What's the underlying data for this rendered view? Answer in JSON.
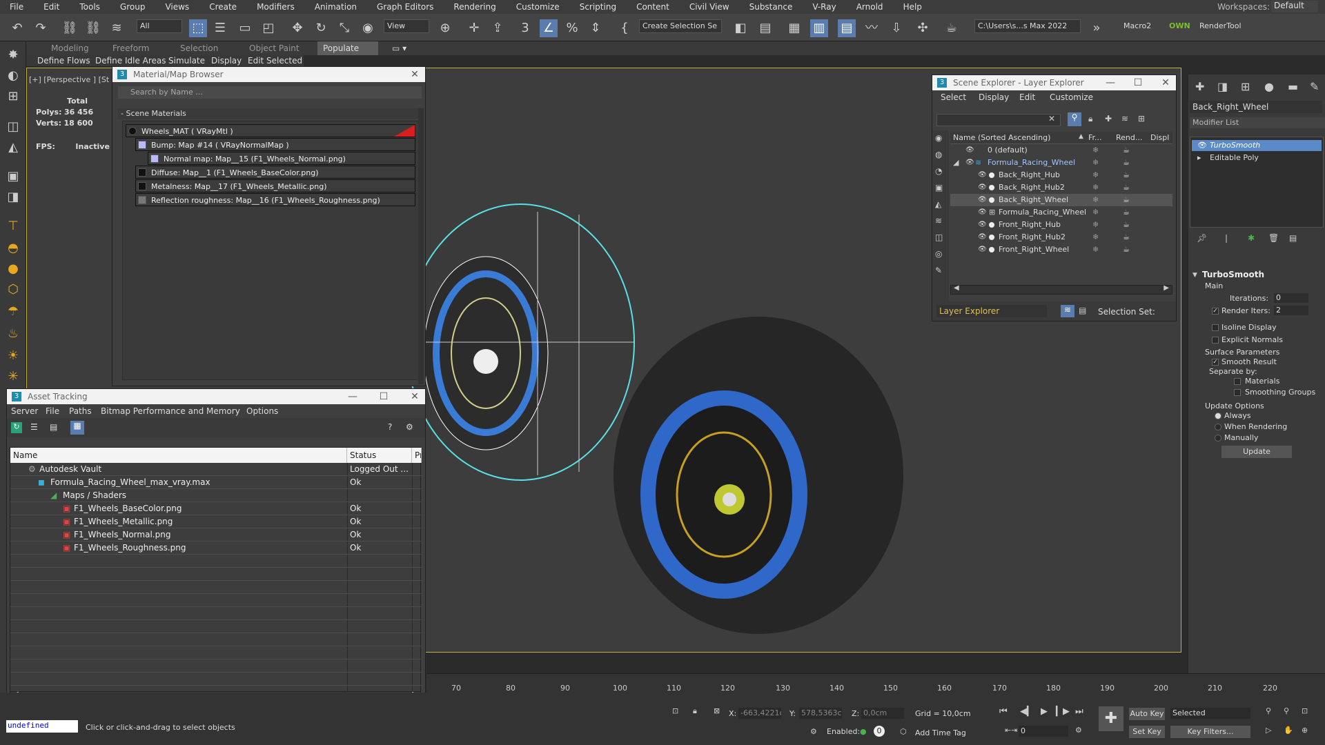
{
  "menubar": {
    "items": [
      "File",
      "Edit",
      "Tools",
      "Group",
      "Views",
      "Create",
      "Modifiers",
      "Animation",
      "Graph Editors",
      "Rendering",
      "Customize",
      "Scripting",
      "Content",
      "Civil View",
      "Substance",
      "V-Ray",
      "Arnold",
      "Help"
    ],
    "workspace_label": "Workspaces:",
    "workspace_value": "Default"
  },
  "toolbar": {
    "filter_value": "All",
    "refcoord_value": "View",
    "selection_set_placeholder": "Create Selection Se",
    "project_path": "C:\\Users\\s...s Max 2022",
    "macro_label": "Macro2",
    "own_label": "OWN",
    "render_tool_label": "RenderTool"
  },
  "ribbon": {
    "tabs": [
      "Modeling",
      "Freeform",
      "Selection",
      "Object Paint",
      "Populate"
    ],
    "active_tab": "Populate",
    "subtabs": [
      "Define Flows",
      "Define Idle Areas",
      "Simulate",
      "Display",
      "Edit Selected"
    ]
  },
  "viewport": {
    "label": "[+] [Perspective ] [St",
    "stats_total": "Total",
    "polys_label": "Polys:",
    "polys_value": "36 456",
    "verts_label": "Verts:",
    "verts_value": "18 600",
    "fps_label": "FPS:",
    "fps_value": "Inactive"
  },
  "material_browser": {
    "title": "Material/Map Browser",
    "search_placeholder": "Search by Name ...",
    "section": "- Scene Materials",
    "rows": [
      "Wheels_MAT  ( VRayMtl )",
      "Bump: Map #14  ( VRayNormalMap )",
      "Normal map: Map__15 (F1_Wheels_Normal.png)",
      "Diffuse: Map__1 (F1_Wheels_BaseColor.png)",
      "Metalness: Map__17 (F1_Wheels_Metallic.png)",
      "Reflection roughness: Map__16 (F1_Wheels_Roughness.png)"
    ]
  },
  "asset_tracking": {
    "title": "Asset Tracking",
    "menu": [
      "Server",
      "File",
      "Paths",
      "Bitmap Performance and Memory",
      "Options"
    ],
    "columns": [
      "Name",
      "Status",
      "Pr"
    ],
    "rows": [
      {
        "name": "Autodesk Vault",
        "status": "Logged Out ..."
      },
      {
        "name": "Formula_Racing_Wheel_max_vray.max",
        "status": "Ok"
      },
      {
        "name": "Maps / Shaders",
        "status": ""
      },
      {
        "name": "F1_Wheels_BaseColor.png",
        "status": "Ok"
      },
      {
        "name": "F1_Wheels_Metallic.png",
        "status": "Ok"
      },
      {
        "name": "F1_Wheels_Normal.png",
        "status": "Ok"
      },
      {
        "name": "F1_Wheels_Roughness.png",
        "status": "Ok"
      }
    ]
  },
  "scene_explorer": {
    "title": "Scene Explorer - Layer Explorer",
    "menu": [
      "Select",
      "Display",
      "Edit",
      "Customize"
    ],
    "col_name": "Name (Sorted Ascending)",
    "col_freeze": "Fr...",
    "col_render": "Rend...",
    "col_display": "Displ",
    "rows": [
      "0 (default)",
      "Formula_Racing_Wheel",
      "Back_Right_Hub",
      "Back_Right_Hub2",
      "Back_Right_Wheel",
      "Formula_Racing_Wheel",
      "Front_Right_Hub",
      "Front_Right_Hub2",
      "Front_Right_Wheel"
    ],
    "layer_explorer": "Layer Explorer",
    "selection_set": "Selection Set:"
  },
  "modify_panel": {
    "object_name": "Back_Right_Wheel",
    "modifier_list": "Modifier List",
    "stack": [
      "TurboSmooth",
      "Editable Poly"
    ],
    "turbosmooth_title": "TurboSmooth",
    "main": "Main",
    "iterations_label": "Iterations:",
    "iterations_value": "0",
    "render_iters_label": "Render Iters:",
    "render_iters_value": "2",
    "isoline": "Isoline Display",
    "explicit_normals": "Explicit Normals",
    "surface_params": "Surface Parameters",
    "smooth_result": "Smooth Result",
    "separate_by": "Separate by:",
    "materials": "Materials",
    "smoothing_groups": "Smoothing Groups",
    "update_options": "Update Options",
    "always": "Always",
    "when_rendering": "When Rendering",
    "manually": "Manually",
    "update_btn": "Update"
  },
  "timeline": {
    "ticks": [
      "70",
      "80",
      "90",
      "100",
      "110",
      "120",
      "130",
      "140",
      "150",
      "160",
      "170",
      "180",
      "190",
      "200",
      "210",
      "220"
    ]
  },
  "statusbar": {
    "listener": "undefined",
    "prompt": "Click or click-and-drag to select objects",
    "x_label": "X:",
    "x_value": "-663,4221c",
    "y_label": "Y:",
    "y_value": "578,5363c",
    "z_label": "Z:",
    "z_value": "0,0cm",
    "grid": "Grid = 10,0cm",
    "enabled": "Enabled:",
    "add_time_tag": "Add Time Tag",
    "auto_key": "Auto Key",
    "set_key": "Set Key",
    "selected": "Selected",
    "key_filters": "Key Filters...",
    "frame": "0"
  }
}
